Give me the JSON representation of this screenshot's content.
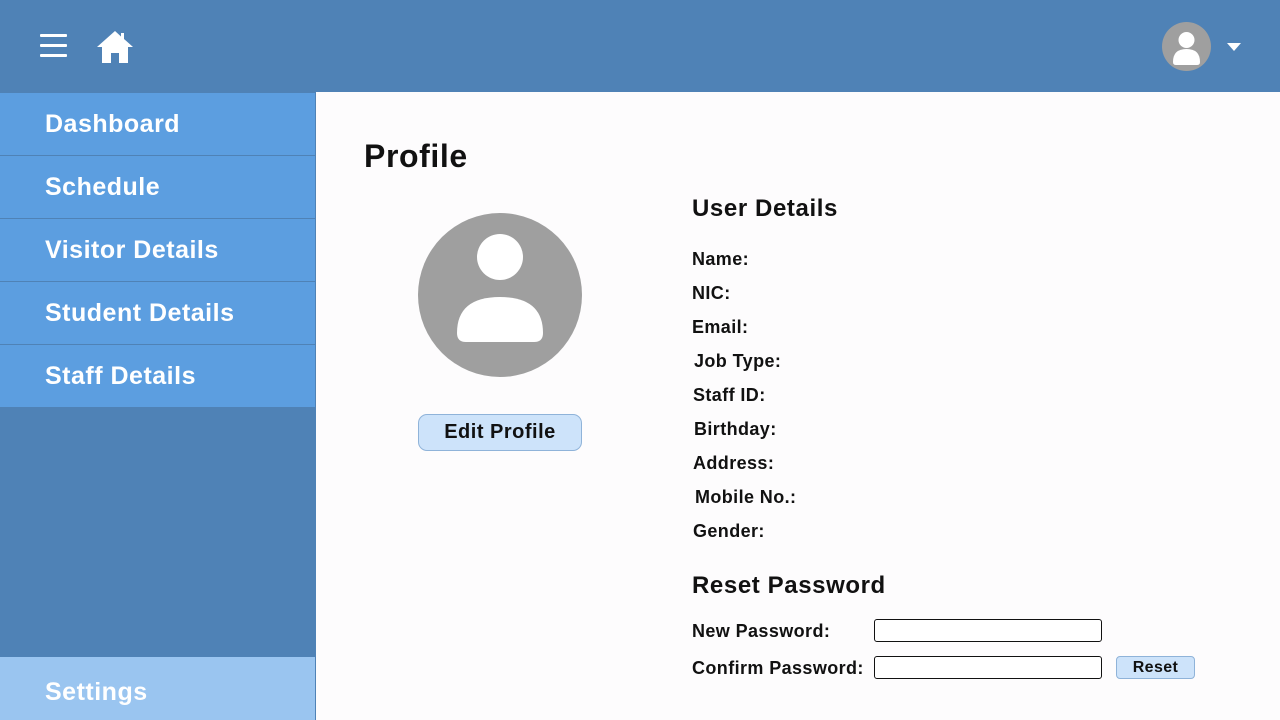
{
  "header": {
    "menu_icon": "hamburger-menu-icon",
    "home_icon": "home-icon",
    "avatar_icon": "user-avatar-icon",
    "dropdown_icon": "caret-down-icon"
  },
  "sidebar": {
    "items": [
      {
        "label": "Dashboard"
      },
      {
        "label": "Schedule"
      },
      {
        "label": "Visitor Details"
      },
      {
        "label": "Student Details"
      },
      {
        "label": "Staff Details"
      }
    ],
    "settings_label": "Settings"
  },
  "main": {
    "title": "Profile",
    "edit_profile_label": "Edit Profile",
    "user_details": {
      "title": "User Details",
      "fields": [
        "Name:",
        "NIC:",
        "Email:",
        "Job Type:",
        "Staff ID:",
        "Birthday:",
        "Address:",
        "Mobile No.:",
        "Gender:"
      ]
    },
    "reset_password": {
      "title": "Reset Password",
      "new_password_label": "New Password:",
      "confirm_password_label": "Confirm Password:",
      "new_password_value": "",
      "confirm_password_value": "",
      "reset_label": "Reset"
    }
  },
  "colors": {
    "header": "#4f82b6",
    "sidebar_item": "#5c9ee0",
    "settings_item": "#9ac5f0",
    "button": "#cde3fa",
    "avatar": "#9f9f9f"
  }
}
